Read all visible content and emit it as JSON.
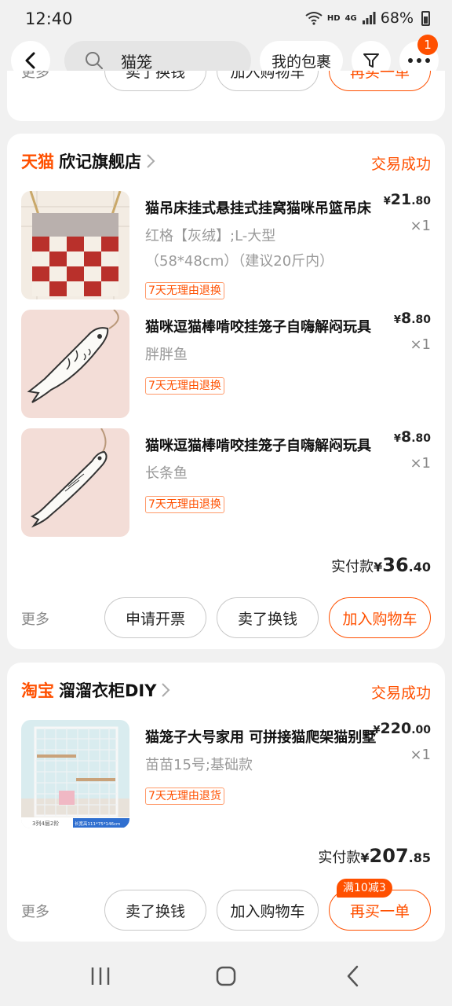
{
  "status_bar": {
    "time": "12:40",
    "network_hd": "HD",
    "network_type": "4G",
    "battery": "68%"
  },
  "header": {
    "search_text": "猫笼",
    "package_label": "我的包裹",
    "notification_count": "1"
  },
  "prev_order": {
    "more_label": "更多",
    "btn_sell": "卖了换钱",
    "btn_cart": "加入购物车",
    "btn_rebuy": "再买一单"
  },
  "orders": [
    {
      "platform": "天猫",
      "shop_name": "欣记旗舰店",
      "status": "交易成功",
      "items": [
        {
          "title": "猫吊床挂式悬挂式挂窝猫咪吊篮吊床",
          "sku_line1": "红格【灰绒】;L-大型",
          "sku_line2": "（58*48cm）（建议20斤内）",
          "price_currency": "¥",
          "price_int": "21",
          "price_dec": ".80",
          "qty": "×1",
          "tag": "7天无理由退换"
        },
        {
          "title": "猫咪逗猫棒啃咬挂笼子自嗨解闷玩具",
          "sku_line1": "胖胖鱼",
          "sku_line2": "",
          "price_currency": "¥",
          "price_int": "8",
          "price_dec": ".80",
          "qty": "×1",
          "tag": "7天无理由退换"
        },
        {
          "title": "猫咪逗猫棒啃咬挂笼子自嗨解闷玩具",
          "sku_line1": "长条鱼",
          "sku_line2": "",
          "price_currency": "¥",
          "price_int": "8",
          "price_dec": ".80",
          "qty": "×1",
          "tag": "7天无理由退换"
        }
      ],
      "total_label": "实付款",
      "total_currency": "¥",
      "total_int": "36",
      "total_dec": ".40",
      "more_label": "更多",
      "btn_invoice": "申请开票",
      "btn_sell": "卖了换钱",
      "btn_cart": "加入购物车"
    },
    {
      "platform": "淘宝",
      "shop_name": "溜溜衣柜DIY",
      "status": "交易成功",
      "items": [
        {
          "title": "猫笼子大号家用 可拼接猫爬架猫别墅",
          "sku_line1": "苗苗15号;基础款",
          "sku_line2": "",
          "price_currency": "¥",
          "price_int": "220",
          "price_dec": ".00",
          "qty": "×1",
          "tag": "7天无理由退货",
          "thumb_caption_left": "3列4层2阶",
          "thumb_caption_right": "长宽高111*75*146cm"
        }
      ],
      "total_label": "实付款",
      "total_currency": "¥",
      "total_int": "207",
      "total_dec": ".85",
      "more_label": "更多",
      "btn_sell": "卖了换钱",
      "btn_cart": "加入购物车",
      "btn_rebuy": "再买一单",
      "promo": "满10减3"
    }
  ],
  "colors": {
    "accent": "#ff5000",
    "background": "#f1f1f1",
    "card": "#ffffff",
    "muted": "#999999"
  },
  "icons": [
    "back-arrow-icon",
    "search-icon",
    "filter-icon",
    "more-dots-icon",
    "chevron-right-icon",
    "wifi-icon",
    "signal-icon",
    "battery-icon",
    "recent-apps-icon",
    "home-icon",
    "back-nav-icon"
  ]
}
